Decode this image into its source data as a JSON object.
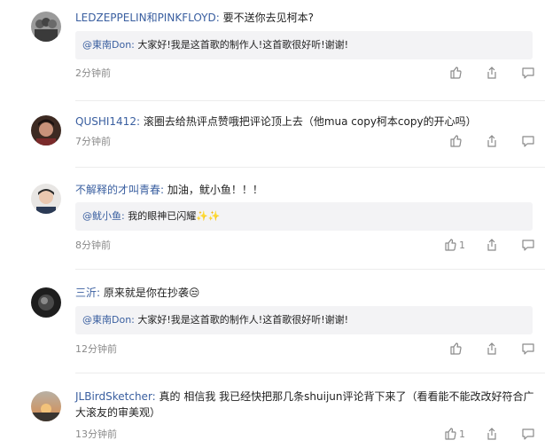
{
  "comments": [
    {
      "user": "LEDZEPPELIN和PINKFLOYD",
      "text": "要不送你去见柯本?",
      "reply_user": "@東南Don",
      "reply_text": "大家好!我是这首歌的制作人!这首歌很好听!谢谢!",
      "time": "2分钟前",
      "likes": ""
    },
    {
      "user": "QUSHI1412",
      "text": "滚圈去给热评点赞哦把评论顶上去（他mua copy柯本copy的开心吗）",
      "reply_user": "",
      "reply_text": "",
      "time": "7分钟前",
      "likes": ""
    },
    {
      "user": "不解释的才叫青春",
      "text": "加油，鱿小鱼！！！",
      "reply_user": "@鱿小鱼",
      "reply_text": "我的眼神已闪耀✨✨",
      "time": "8分钟前",
      "likes": "1"
    },
    {
      "user": "三沂",
      "text": "原来就是你在抄袭😒",
      "reply_user": "@東南Don",
      "reply_text": "大家好!我是这首歌的制作人!这首歌很好听!谢谢!",
      "time": "12分钟前",
      "likes": ""
    },
    {
      "user": "JLBirdSketcher",
      "text": "真的 相信我 我已经快把那几条shuijun评论背下来了（看看能不能改改好符合广大滚友的审美观）",
      "reply_user": "",
      "reply_text": "",
      "time": "13分钟前",
      "likes": "1"
    }
  ],
  "icons": {
    "like": "thumbs-up-icon",
    "share": "share-icon",
    "reply": "comment-icon"
  },
  "colors": {
    "username": "#3a5fa0",
    "text": "#222222",
    "meta": "#8a8a8a",
    "reply_bg": "#f3f3f5"
  }
}
